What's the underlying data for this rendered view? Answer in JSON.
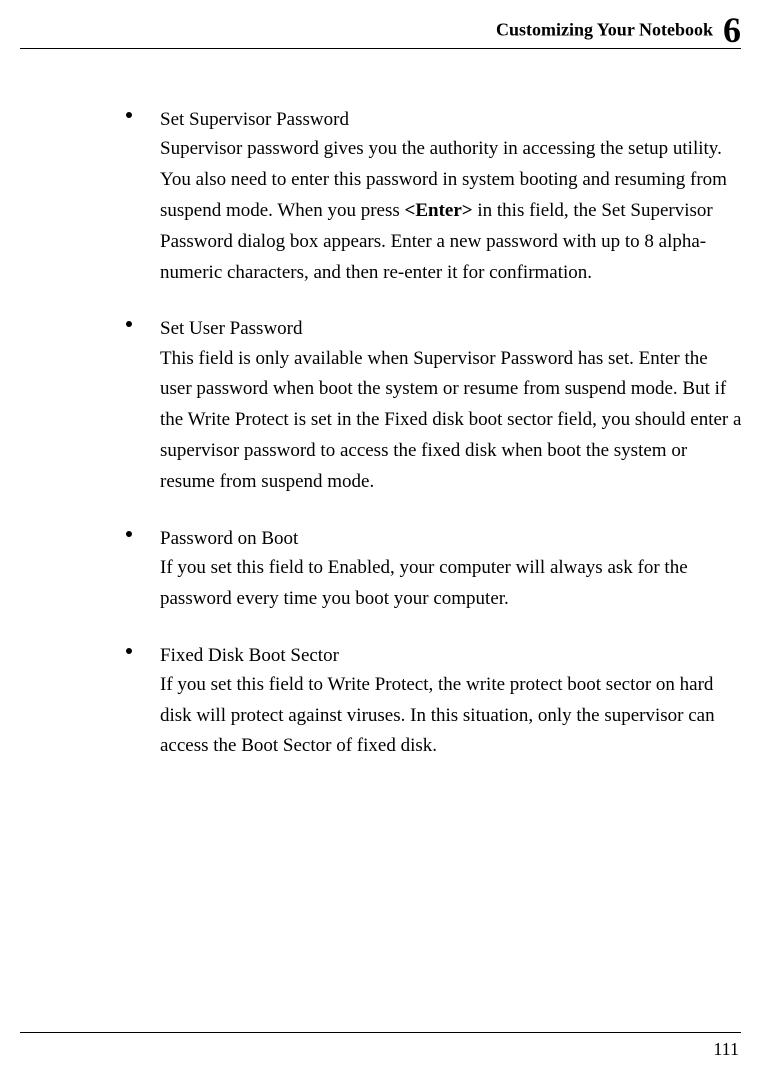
{
  "header": {
    "title": "Customizing Your Notebook",
    "chapter": "6"
  },
  "items": [
    {
      "title": "Set Supervisor Password",
      "body_pre": "Supervisor password gives you the authority in accessing the setup utility. You also need to enter this password in system booting and resuming from suspend mode. When you press ",
      "body_bold": "<Enter>",
      "body_post": " in this field, the Set Supervisor Password dialog box appears. Enter a new password with up to 8 alpha-numeric characters, and then re-enter it for confirmation."
    },
    {
      "title": "Set User Password",
      "body_pre": "This field is only available when Supervisor Password has set. Enter the user password when boot the system or resume from suspend mode. But if the Write Protect is set in the Fixed disk boot sector field, you should enter a supervisor password to access the fixed disk when boot the system or resume from suspend mode.",
      "body_bold": "",
      "body_post": ""
    },
    {
      "title": "Password on Boot",
      "body_pre": "If you set this field to Enabled, your computer will always ask for the password every time you boot your computer.",
      "body_bold": "",
      "body_post": ""
    },
    {
      "title": "Fixed Disk Boot Sector",
      "body_pre": "If you set this field to Write Protect, the write protect boot sector on hard disk will protect against viruses. In this situation, only the supervisor can access the Boot Sector of fixed disk.",
      "body_bold": "",
      "body_post": ""
    }
  ],
  "page_number": "111"
}
